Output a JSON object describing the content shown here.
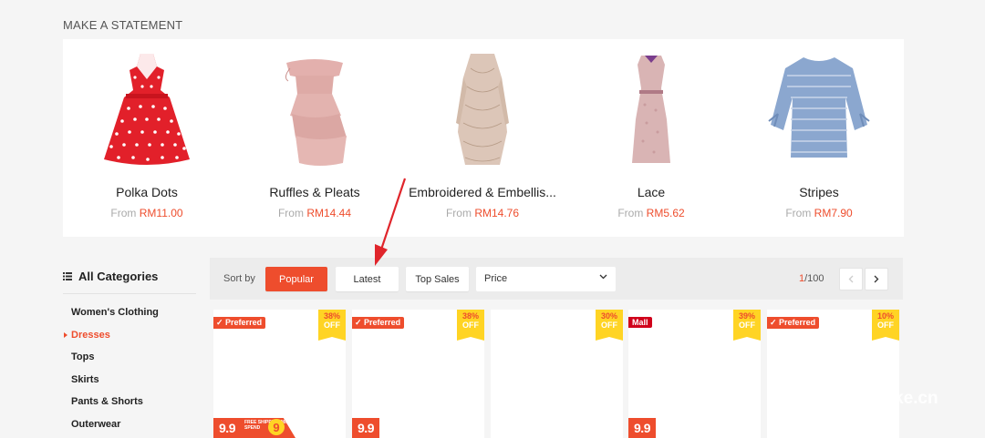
{
  "section_title": "MAKE A STATEMENT",
  "statement_items": [
    {
      "name": "Polka Dots",
      "from": "From",
      "price": "RM11.00"
    },
    {
      "name": "Ruffles & Pleats",
      "from": "From",
      "price": "RM14.44"
    },
    {
      "name": "Embroidered & Embellis...",
      "from": "From",
      "price": "RM14.76"
    },
    {
      "name": "Lace",
      "from": "From",
      "price": "RM5.62"
    },
    {
      "name": "Stripes",
      "from": "From",
      "price": "RM7.90"
    }
  ],
  "sidebar": {
    "title": "All Categories",
    "items": [
      {
        "label": "Women's Clothing"
      },
      {
        "label": "Dresses"
      },
      {
        "label": "Tops"
      },
      {
        "label": "Skirts"
      },
      {
        "label": "Pants & Shorts"
      },
      {
        "label": "Outerwear"
      }
    ]
  },
  "sortbar": {
    "label": "Sort by",
    "popular": "Popular",
    "latest": "Latest",
    "top_sales": "Top Sales",
    "price": "Price",
    "page_current": "1",
    "page_total": "/100"
  },
  "products": [
    {
      "tag": "Preferred",
      "discount_pct": "38%",
      "discount_off": "OFF",
      "badge": "9.9",
      "shipping_text": "FREE SHIPPING MIN. SPEND",
      "shipping_amount": "9"
    },
    {
      "tag": "Preferred",
      "discount_pct": "38%",
      "discount_off": "OFF",
      "badge": "9.9"
    },
    {
      "discount_pct": "30%",
      "discount_off": "OFF"
    },
    {
      "tag": "Mall",
      "discount_pct": "39%",
      "discount_off": "OFF",
      "badge": "9.9"
    },
    {
      "tag": "Preferred",
      "discount_pct": "10%",
      "discount_off": "OFF"
    }
  ],
  "watermark": "ke.cn",
  "colors": {
    "accent": "#ee4d2d",
    "discount_bg": "#ffd424",
    "mall": "#d0011b"
  }
}
